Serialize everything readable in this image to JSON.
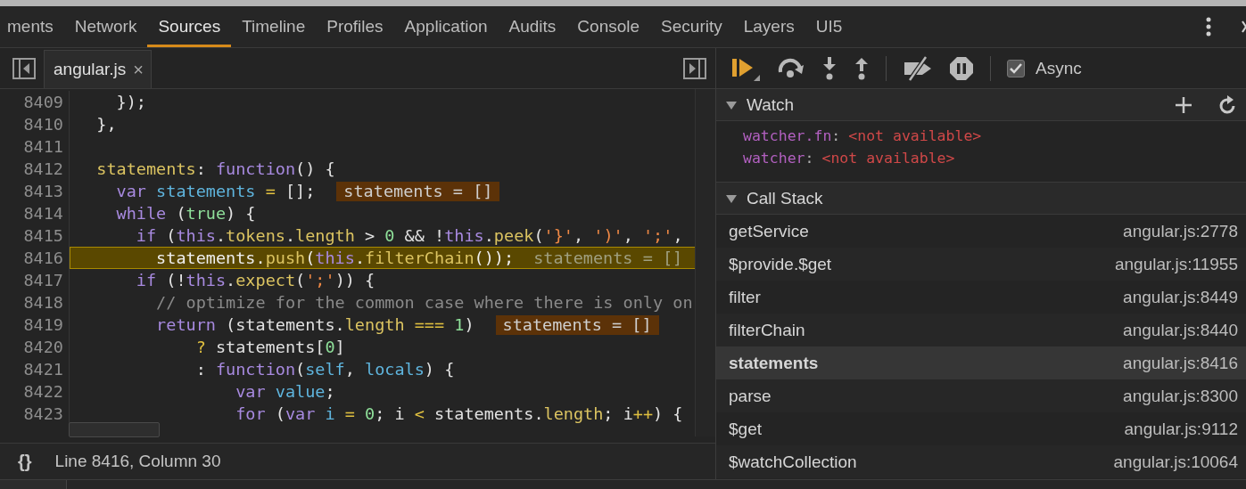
{
  "tabs": [
    {
      "label": "ments",
      "selected": false
    },
    {
      "label": "Network",
      "selected": false
    },
    {
      "label": "Sources",
      "selected": true
    },
    {
      "label": "Timeline",
      "selected": false
    },
    {
      "label": "Profiles",
      "selected": false
    },
    {
      "label": "Application",
      "selected": false
    },
    {
      "label": "Audits",
      "selected": false
    },
    {
      "label": "Console",
      "selected": false
    },
    {
      "label": "Security",
      "selected": false
    },
    {
      "label": "Layers",
      "selected": false
    },
    {
      "label": "UI5",
      "selected": false
    }
  ],
  "editor": {
    "file_tab": {
      "label": "angular.js",
      "close_glyph": "×"
    },
    "lines": [
      {
        "number": "8409",
        "paused": false,
        "tokens": [
          {
            "kind": "plain",
            "text": "    });"
          }
        ]
      },
      {
        "number": "8410",
        "paused": false,
        "tokens": [
          {
            "kind": "plain",
            "text": "  },"
          }
        ]
      },
      {
        "number": "8411",
        "paused": false
      },
      {
        "number": "8412",
        "paused": false,
        "tokens": [
          {
            "kind": "property",
            "text": "  statements"
          },
          {
            "kind": "plain",
            "text": ": "
          },
          {
            "kind": "keyword",
            "text": "function"
          },
          {
            "kind": "plain",
            "text": "() {"
          }
        ]
      },
      {
        "number": "8413",
        "paused": false,
        "inline_value": "statements = []",
        "tokens": [
          {
            "kind": "keyword",
            "text": "    var"
          },
          {
            "kind": "variable",
            "text": " statements"
          },
          {
            "kind": "operator",
            "text": " ="
          },
          {
            "kind": "plain",
            "text": " [];"
          }
        ]
      },
      {
        "number": "8414",
        "paused": false,
        "tokens": [
          {
            "kind": "keyword",
            "text": "    while"
          },
          {
            "kind": "plain",
            "text": " ("
          },
          {
            "kind": "atom",
            "text": "true"
          },
          {
            "kind": "plain",
            "text": ") {"
          }
        ]
      },
      {
        "number": "8415",
        "paused": false,
        "tokens": [
          {
            "kind": "keyword",
            "text": "      if"
          },
          {
            "kind": "plain",
            "text": " ("
          },
          {
            "kind": "keyword",
            "text": "this"
          },
          {
            "kind": "plain",
            "text": "."
          },
          {
            "kind": "property",
            "text": "tokens"
          },
          {
            "kind": "plain",
            "text": "."
          },
          {
            "kind": "property",
            "text": "length"
          },
          {
            "kind": "plain",
            "text": " > "
          },
          {
            "kind": "atom",
            "text": "0"
          },
          {
            "kind": "plain",
            "text": " && !"
          },
          {
            "kind": "keyword",
            "text": "this"
          },
          {
            "kind": "plain",
            "text": "."
          },
          {
            "kind": "property",
            "text": "peek"
          },
          {
            "kind": "plain",
            "text": "("
          },
          {
            "kind": "string",
            "text": "'}'"
          },
          {
            "kind": "plain",
            "text": ", "
          },
          {
            "kind": "string",
            "text": "')'"
          },
          {
            "kind": "plain",
            "text": ", "
          },
          {
            "kind": "string",
            "text": "';'"
          },
          {
            "kind": "plain",
            "text": ","
          }
        ]
      },
      {
        "number": "8416",
        "paused": true,
        "inline_value": "statements = []",
        "tokens": [
          {
            "kind": "plain",
            "text": "        statements."
          },
          {
            "kind": "property",
            "text": "push"
          },
          {
            "kind": "plain",
            "text": "("
          },
          {
            "kind": "keyword",
            "text": "this"
          },
          {
            "kind": "plain",
            "text": "."
          },
          {
            "kind": "property",
            "text": "filterChain"
          },
          {
            "kind": "plain",
            "text": "());"
          }
        ]
      },
      {
        "number": "8417",
        "paused": false,
        "tokens": [
          {
            "kind": "keyword",
            "text": "      if"
          },
          {
            "kind": "plain",
            "text": " (!"
          },
          {
            "kind": "keyword",
            "text": "this"
          },
          {
            "kind": "plain",
            "text": "."
          },
          {
            "kind": "property",
            "text": "expect"
          },
          {
            "kind": "plain",
            "text": "("
          },
          {
            "kind": "string",
            "text": "';'"
          },
          {
            "kind": "plain",
            "text": ")) {"
          }
        ]
      },
      {
        "number": "8418",
        "paused": false,
        "tokens": [
          {
            "kind": "comment",
            "text": "        // optimize for the common case where there is only on"
          }
        ]
      },
      {
        "number": "8419",
        "paused": false,
        "inline_value": "statements = []",
        "tokens": [
          {
            "kind": "keyword",
            "text": "        return"
          },
          {
            "kind": "plain",
            "text": " (statements."
          },
          {
            "kind": "property",
            "text": "length"
          },
          {
            "kind": "operator",
            "text": " ==="
          },
          {
            "kind": "atom",
            "text": " 1"
          },
          {
            "kind": "plain",
            "text": ")"
          }
        ]
      },
      {
        "number": "8420",
        "paused": false,
        "tokens": [
          {
            "kind": "operator",
            "text": "            ?"
          },
          {
            "kind": "plain",
            "text": " statements["
          },
          {
            "kind": "atom",
            "text": "0"
          },
          {
            "kind": "plain",
            "text": "]"
          }
        ]
      },
      {
        "number": "8421",
        "paused": false,
        "tokens": [
          {
            "kind": "plain",
            "text": "            : "
          },
          {
            "kind": "keyword",
            "text": "function"
          },
          {
            "kind": "plain",
            "text": "("
          },
          {
            "kind": "variable",
            "text": "self"
          },
          {
            "kind": "plain",
            "text": ", "
          },
          {
            "kind": "variable",
            "text": "locals"
          },
          {
            "kind": "plain",
            "text": ") {"
          }
        ]
      },
      {
        "number": "8422",
        "paused": false,
        "tokens": [
          {
            "kind": "keyword",
            "text": "                var"
          },
          {
            "kind": "variable",
            "text": " value"
          },
          {
            "kind": "plain",
            "text": ";"
          }
        ]
      },
      {
        "number": "8423",
        "paused": false,
        "tokens": [
          {
            "kind": "keyword",
            "text": "                for"
          },
          {
            "kind": "plain",
            "text": " ("
          },
          {
            "kind": "keyword",
            "text": "var"
          },
          {
            "kind": "variable",
            "text": " i"
          },
          {
            "kind": "operator",
            "text": " ="
          },
          {
            "kind": "atom",
            "text": " 0"
          },
          {
            "kind": "plain",
            "text": "; i "
          },
          {
            "kind": "operator",
            "text": "<"
          },
          {
            "kind": "plain",
            "text": " statements."
          },
          {
            "kind": "property",
            "text": "length"
          },
          {
            "kind": "plain",
            "text": "; i"
          },
          {
            "kind": "operator",
            "text": "++"
          },
          {
            "kind": "plain",
            "text": ") {"
          }
        ]
      }
    ],
    "status": {
      "format_glyph": "{}",
      "position": "Line 8416, Column 30"
    }
  },
  "debugger": {
    "async": {
      "label": "Async",
      "checked": true
    },
    "watch": {
      "title": "Watch",
      "expanded": true,
      "items": [
        {
          "name": "watcher.fn",
          "separator": ":",
          "value": "<not available>"
        },
        {
          "name": "watcher",
          "separator": ":",
          "value": "<not available>"
        }
      ]
    },
    "call_stack": {
      "title": "Call Stack",
      "expanded": true,
      "frames": [
        {
          "name": "getService",
          "location": "angular.js:2778",
          "selected": false
        },
        {
          "name": "$provide.$get",
          "location": "angular.js:11955",
          "selected": false
        },
        {
          "name": "filter",
          "location": "angular.js:8449",
          "selected": false
        },
        {
          "name": "filterChain",
          "location": "angular.js:8440",
          "selected": false
        },
        {
          "name": "statements",
          "location": "angular.js:8416",
          "selected": true
        },
        {
          "name": "parse",
          "location": "angular.js:8300",
          "selected": false
        },
        {
          "name": "$get",
          "location": "angular.js:9112",
          "selected": false
        },
        {
          "name": "$watchCollection",
          "location": "angular.js:10064",
          "selected": false
        }
      ]
    }
  }
}
